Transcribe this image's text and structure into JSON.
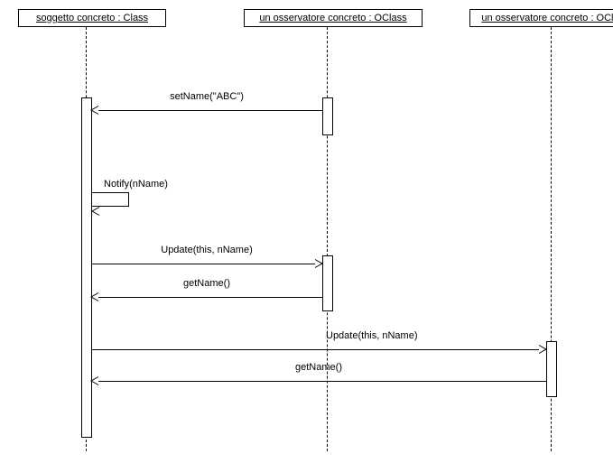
{
  "participants": {
    "p1": "soggetto concreto : Class",
    "p2": "un osservatore concreto : OClass",
    "p3": "un osservatore concreto : OCla"
  },
  "messages": {
    "m1": "setName(\"ABC\")",
    "m2": "Notify(nName)",
    "m3": "Update(this, nName)",
    "m4": "getName()",
    "m5": "Update(this, nName)",
    "m6": "getName()"
  },
  "chart_data": {
    "type": "uml-sequence-diagram",
    "participants": [
      {
        "id": "p1",
        "name": "soggetto concreto",
        "class": "Class"
      },
      {
        "id": "p2",
        "name": "un osservatore concreto",
        "class": "OClass"
      },
      {
        "id": "p3",
        "name": "un osservatore concreto",
        "class": "OClass (truncated)"
      }
    ],
    "messages": [
      {
        "from": "p2",
        "to": "p1",
        "label": "setName(\"ABC\")",
        "activates_from": true,
        "activates_to": true
      },
      {
        "from": "p1",
        "to": "p1",
        "label": "Notify(nName)",
        "self": true
      },
      {
        "from": "p1",
        "to": "p2",
        "label": "Update(this, nName)",
        "activates_to": true
      },
      {
        "from": "p2",
        "to": "p1",
        "label": "getName()"
      },
      {
        "from": "p1",
        "to": "p3",
        "label": "Update(this, nName)",
        "activates_to": true
      },
      {
        "from": "p3",
        "to": "p1",
        "label": "getName()"
      }
    ]
  }
}
